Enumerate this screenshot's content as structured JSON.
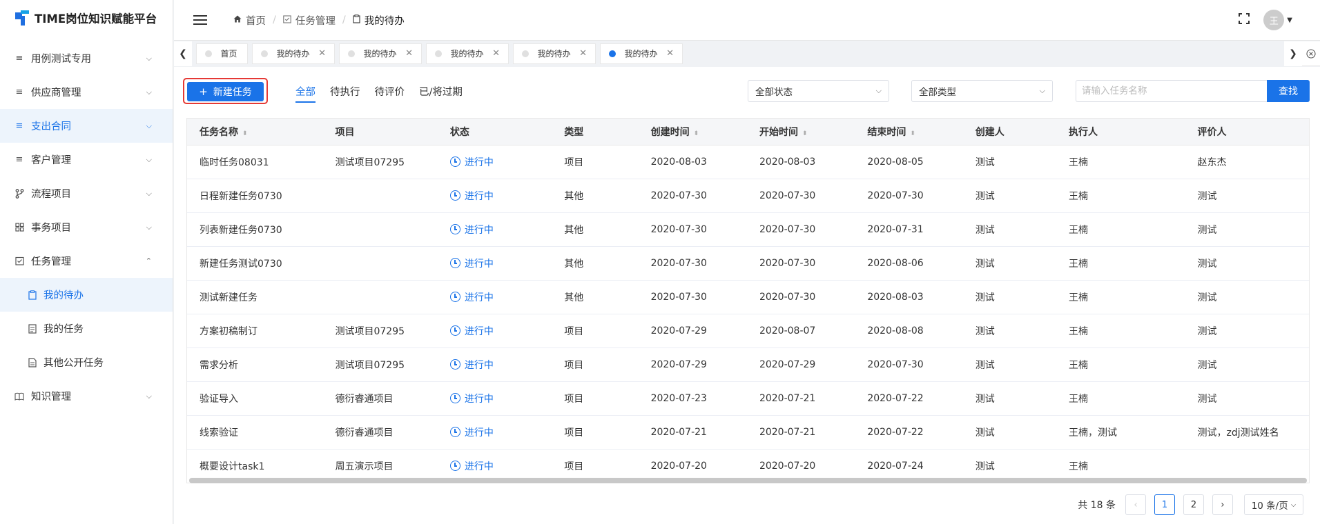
{
  "app": {
    "title": "TIME岗位知识赋能平台"
  },
  "sidebar": {
    "items": [
      {
        "label": "用例测试专用",
        "icon": "list-icon"
      },
      {
        "label": "供应商管理",
        "icon": "list-icon"
      },
      {
        "label": "支出合同",
        "icon": "list-icon"
      },
      {
        "label": "客户管理",
        "icon": "list-icon"
      },
      {
        "label": "流程项目",
        "icon": "branch-icon"
      },
      {
        "label": "事务项目",
        "icon": "grid-icon"
      },
      {
        "label": "任务管理",
        "icon": "checkbox-icon"
      },
      {
        "label": "知识管理",
        "icon": "book-icon"
      }
    ],
    "subitems": [
      {
        "label": "我的待办",
        "icon": "clipboard-icon"
      },
      {
        "label": "我的任务",
        "icon": "document-icon"
      },
      {
        "label": "其他公开任务",
        "icon": "file-icon"
      }
    ]
  },
  "breadcrumb": {
    "home": "首页",
    "section": "任务管理",
    "current": "我的待办"
  },
  "user": {
    "avatar": "王"
  },
  "tabs": [
    "首页",
    "我的待办",
    "我的待办",
    "我的待办",
    "我的待办",
    "我的待办"
  ],
  "toolbar": {
    "new_label": "新建任务",
    "filters": [
      "全部",
      "待执行",
      "待评价",
      "已/将过期"
    ],
    "status_select": "全部状态",
    "type_select": "全部类型",
    "search_placeholder": "请输入任务名称",
    "search_label": "查找"
  },
  "table": {
    "columns": [
      "任务名称",
      "项目",
      "状态",
      "类型",
      "创建时间",
      "开始时间",
      "结束时间",
      "创建人",
      "执行人",
      "评价人"
    ],
    "rows": [
      {
        "name": "临时任务08031",
        "project": "测试项目07295",
        "status": "进行中",
        "type": "项目",
        "created": "2020-08-03",
        "start": "2020-08-03",
        "end": "2020-08-05",
        "creator": "测试",
        "executor": "王楠",
        "reviewer": "赵东杰"
      },
      {
        "name": "日程新建任务0730",
        "project": "",
        "status": "进行中",
        "type": "其他",
        "created": "2020-07-30",
        "start": "2020-07-30",
        "end": "2020-07-30",
        "creator": "测试",
        "executor": "王楠",
        "reviewer": "测试"
      },
      {
        "name": "列表新建任务0730",
        "project": "",
        "status": "进行中",
        "type": "其他",
        "created": "2020-07-30",
        "start": "2020-07-30",
        "end": "2020-07-31",
        "creator": "测试",
        "executor": "王楠",
        "reviewer": "测试"
      },
      {
        "name": "新建任务测试0730",
        "project": "",
        "status": "进行中",
        "type": "其他",
        "created": "2020-07-30",
        "start": "2020-07-30",
        "end": "2020-08-06",
        "creator": "测试",
        "executor": "王楠",
        "reviewer": "测试"
      },
      {
        "name": "测试新建任务",
        "project": "",
        "status": "进行中",
        "type": "其他",
        "created": "2020-07-30",
        "start": "2020-07-30",
        "end": "2020-08-03",
        "creator": "测试",
        "executor": "王楠",
        "reviewer": "测试"
      },
      {
        "name": "方案初稿制订",
        "project": "测试项目07295",
        "status": "进行中",
        "type": "项目",
        "created": "2020-07-29",
        "start": "2020-08-07",
        "end": "2020-08-08",
        "creator": "测试",
        "executor": "王楠",
        "reviewer": "测试"
      },
      {
        "name": "需求分析",
        "project": "测试项目07295",
        "status": "进行中",
        "type": "项目",
        "created": "2020-07-29",
        "start": "2020-07-29",
        "end": "2020-07-30",
        "creator": "测试",
        "executor": "王楠",
        "reviewer": "测试"
      },
      {
        "name": "验证导入",
        "project": "德衍睿通项目",
        "status": "进行中",
        "type": "项目",
        "created": "2020-07-23",
        "start": "2020-07-21",
        "end": "2020-07-22",
        "creator": "测试",
        "executor": "王楠",
        "reviewer": "测试"
      },
      {
        "name": "线索验证",
        "project": "德衍睿通项目",
        "status": "进行中",
        "type": "项目",
        "created": "2020-07-21",
        "start": "2020-07-21",
        "end": "2020-07-22",
        "creator": "测试",
        "executor": "王楠，测试",
        "reviewer": "测试，zdj测试姓名"
      },
      {
        "name": "概要设计task1",
        "project": "周五演示项目",
        "status": "进行中",
        "type": "项目",
        "created": "2020-07-20",
        "start": "2020-07-20",
        "end": "2020-07-24",
        "creator": "测试",
        "executor": "王楠",
        "reviewer": ""
      }
    ]
  },
  "pagination": {
    "total": "共 18 条",
    "pages": [
      "1",
      "2"
    ],
    "page_size": "10 条/页"
  }
}
